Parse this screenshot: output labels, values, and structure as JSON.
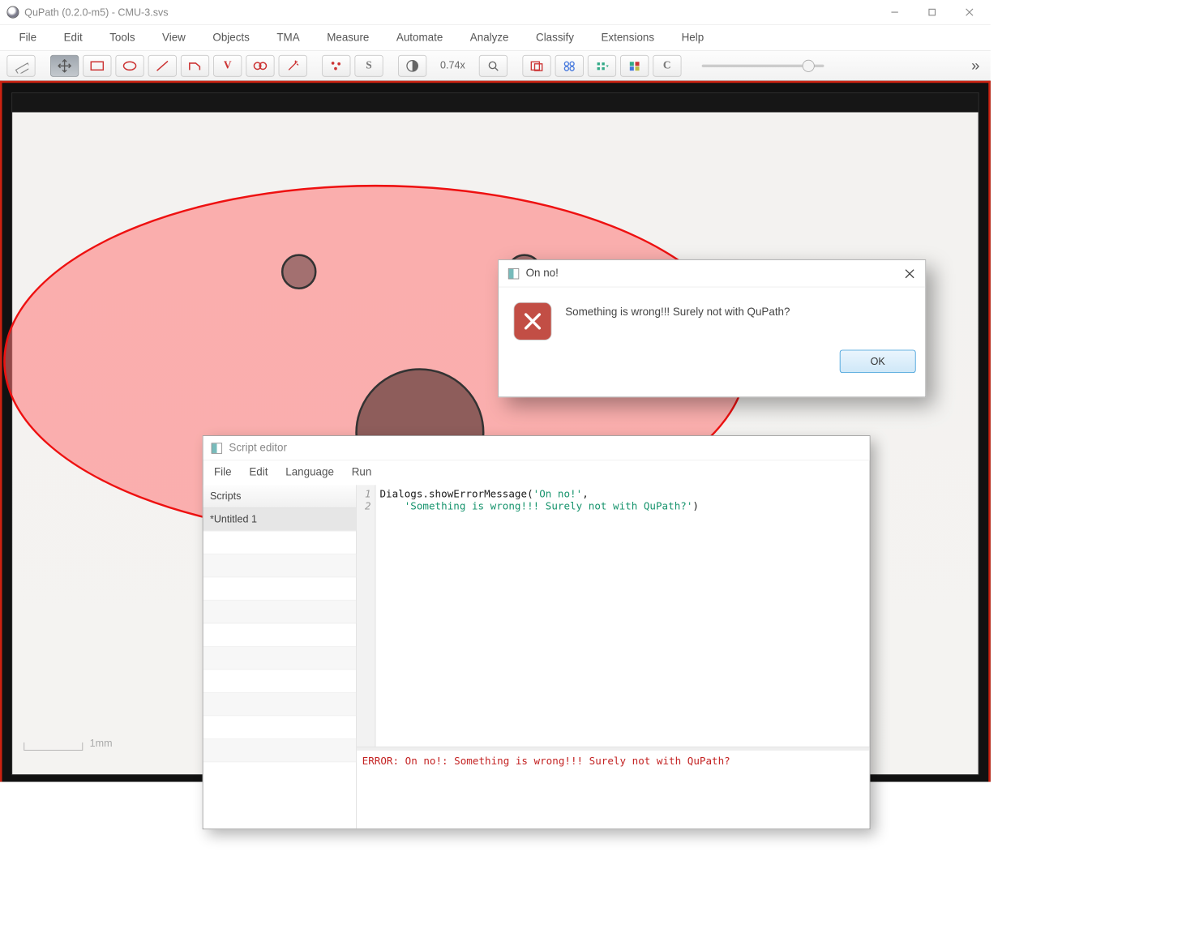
{
  "title": "QuPath (0.2.0-m5) - CMU-3.svs",
  "menubar": [
    "File",
    "Edit",
    "Tools",
    "View",
    "Objects",
    "TMA",
    "Measure",
    "Automate",
    "Analyze",
    "Classify",
    "Extensions",
    "Help"
  ],
  "toolbar": {
    "zoom_text": "0.74x",
    "c_label": "C",
    "s_label": "S",
    "v_label": "V",
    "chevron": "»"
  },
  "scalebar_label": "1mm",
  "script_editor": {
    "title": "Script editor",
    "menubar": [
      "File",
      "Edit",
      "Language",
      "Run"
    ],
    "scripts_header": "Scripts",
    "items": [
      "*Untitled 1"
    ],
    "code_lines": [
      "Dialogs.showErrorMessage('On no!',",
      "    'Something is wrong!!! Surely not with QuPath?')"
    ],
    "console": "ERROR: On no!: Something is wrong!!! Surely not with QuPath?"
  },
  "dialog": {
    "title": "On no!",
    "message": "Something is wrong!!! Surely not with QuPath?",
    "ok_label": "OK"
  }
}
